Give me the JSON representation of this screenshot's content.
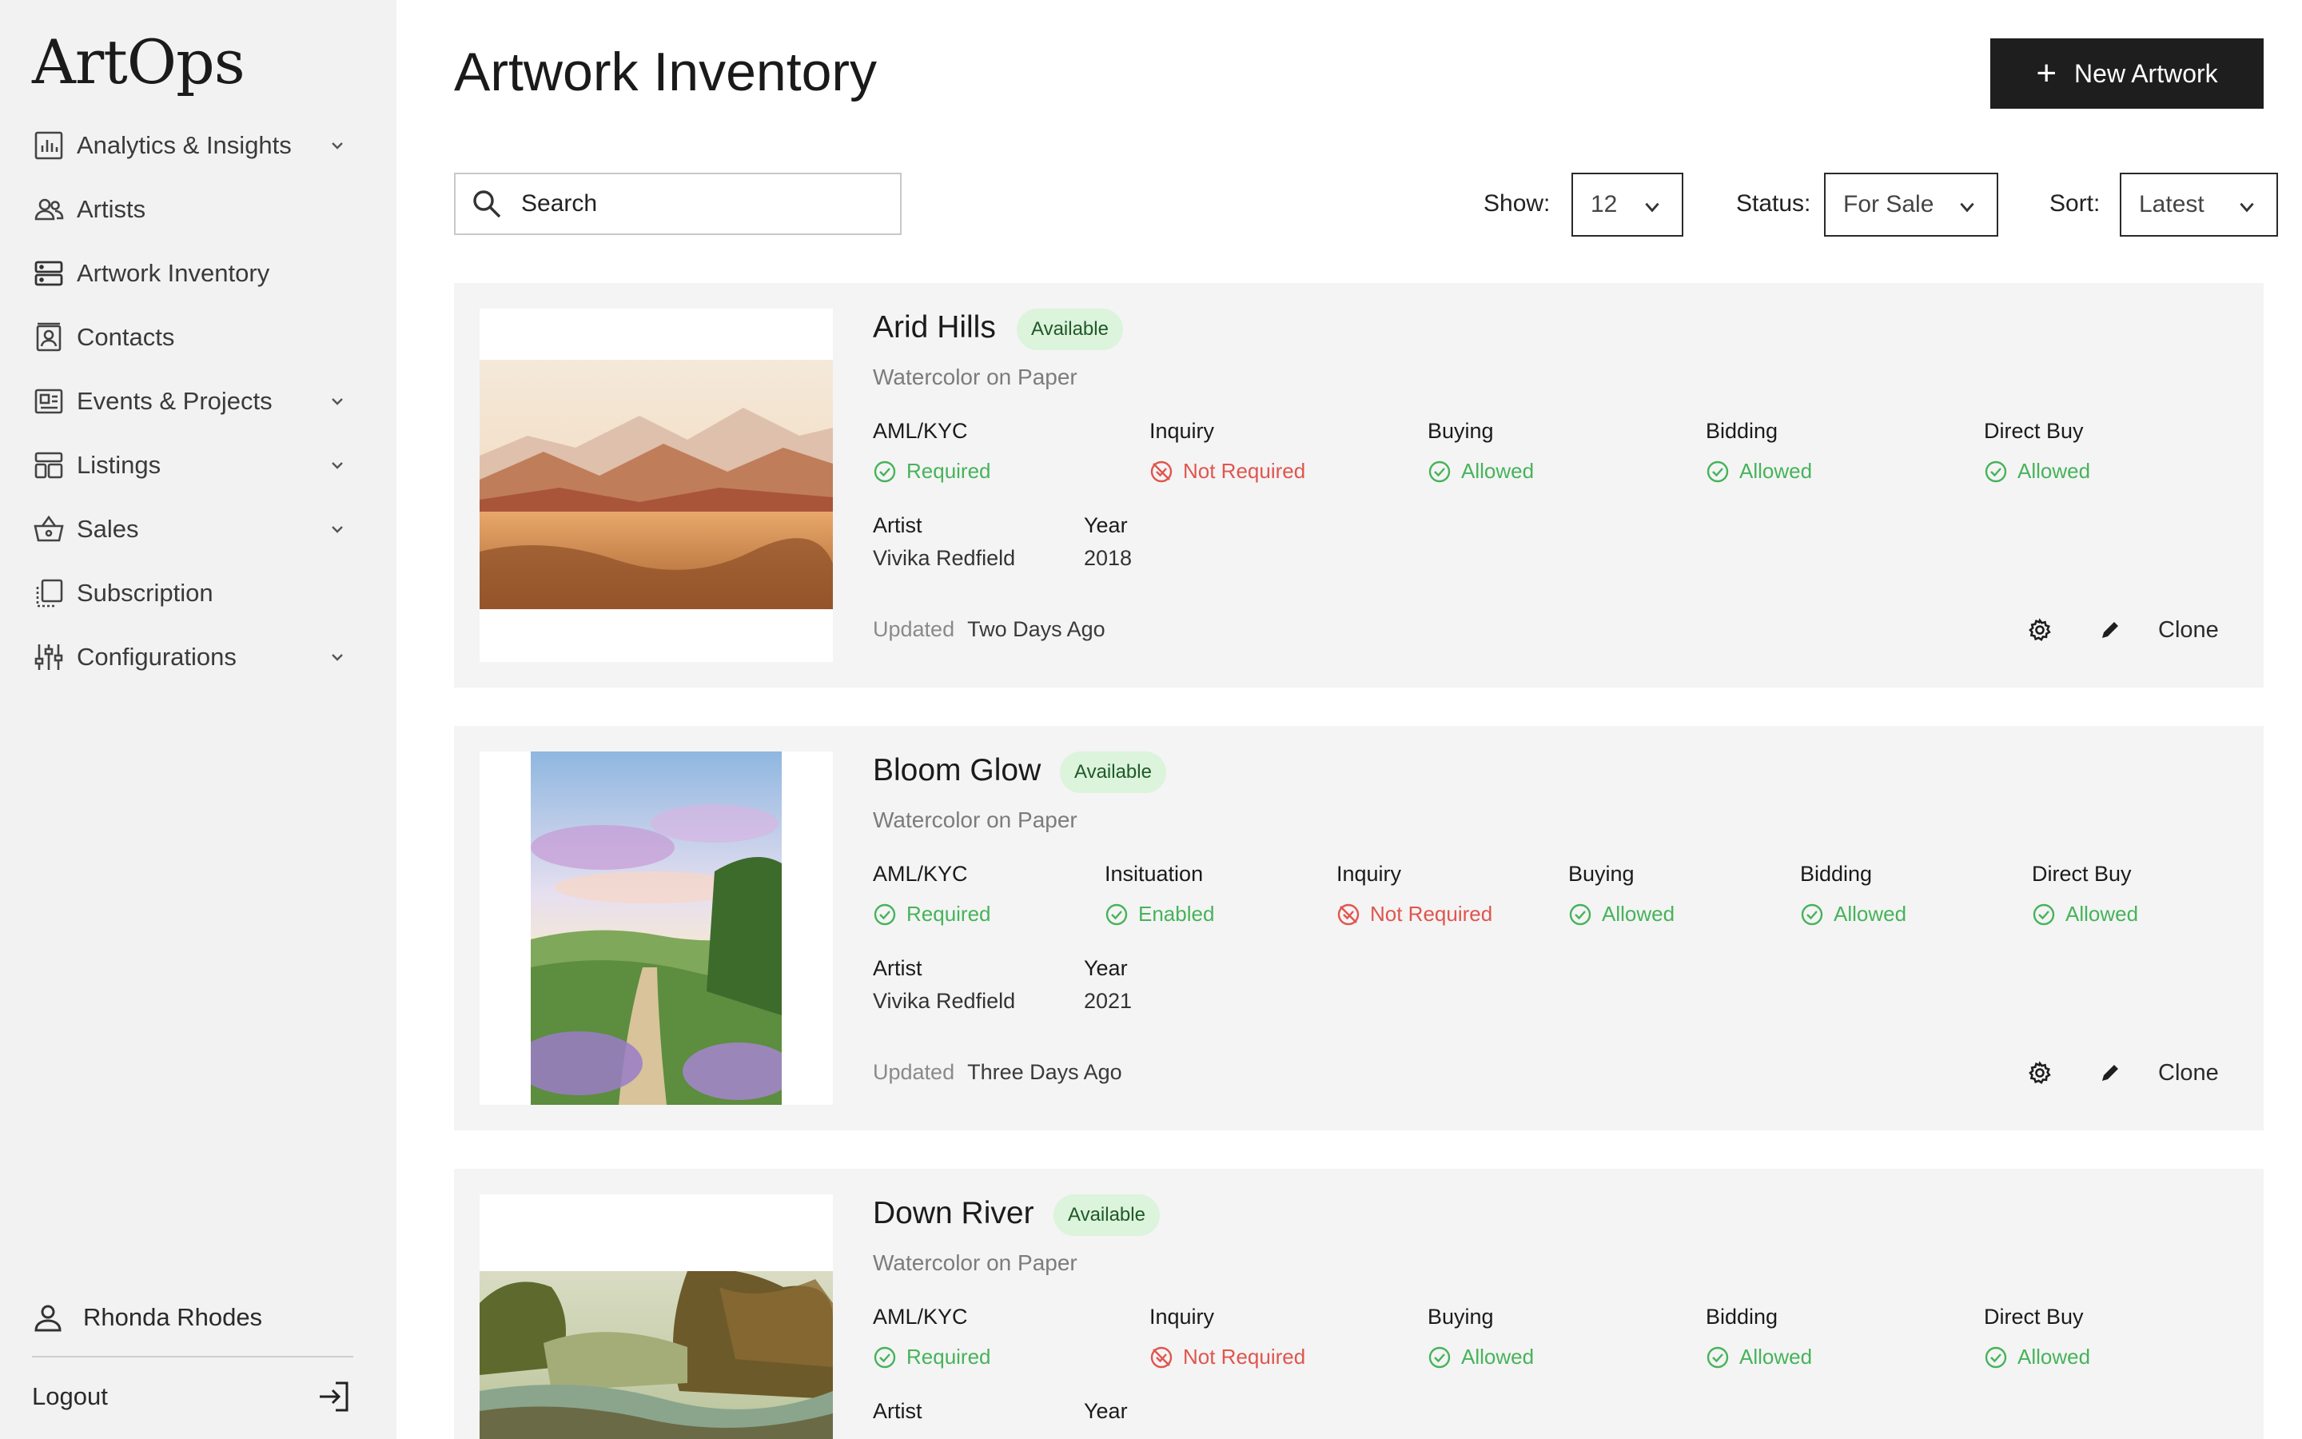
{
  "sidebar": {
    "logo": "ArtOps",
    "items": [
      {
        "label": "Analytics & Insights",
        "icon": "chart-icon",
        "expandable": true
      },
      {
        "label": "Artists",
        "icon": "people-icon",
        "expandable": false
      },
      {
        "label": "Artwork Inventory",
        "icon": "inventory-icon",
        "expandable": false
      },
      {
        "label": "Contacts",
        "icon": "contacts-icon",
        "expandable": false
      },
      {
        "label": "Events & Projects",
        "icon": "events-icon",
        "expandable": true
      },
      {
        "label": "Listings",
        "icon": "listings-icon",
        "expandable": true
      },
      {
        "label": "Sales",
        "icon": "basket-icon",
        "expandable": true
      },
      {
        "label": "Subscription",
        "icon": "subscription-icon",
        "expandable": false
      },
      {
        "label": "Configurations",
        "icon": "sliders-icon",
        "expandable": true
      }
    ],
    "user_name": "Rhonda Rhodes",
    "logout_label": "Logout"
  },
  "header": {
    "title": "Artwork Inventory",
    "new_button": "New Artwork"
  },
  "filters": {
    "search_placeholder": "Search",
    "show_label": "Show:",
    "show_value": "12",
    "status_label": "Status:",
    "status_value": "For Sale",
    "sort_label": "Sort:",
    "sort_value": "Latest"
  },
  "artworks": [
    {
      "title": "Arid Hills",
      "badge": "Available",
      "medium": "Watercolor on Paper",
      "attributes": [
        {
          "label": "AML/KYC",
          "value": "Required",
          "state": "ok"
        },
        {
          "label": "Inquiry",
          "value": "Not Required",
          "state": "bad"
        },
        {
          "label": "Buying",
          "value": "Allowed",
          "state": "ok"
        },
        {
          "label": "Bidding",
          "value": "Allowed",
          "state": "ok"
        },
        {
          "label": "Direct Buy",
          "value": "Allowed",
          "state": "ok"
        }
      ],
      "artist_label": "Artist",
      "artist": "Vivika Redfield",
      "year_label": "Year",
      "year": "2018",
      "updated_label": "Updated",
      "updated": "Two Days Ago",
      "clone_label": "Clone"
    },
    {
      "title": "Bloom Glow",
      "badge": "Available",
      "medium": "Watercolor on Paper",
      "attributes": [
        {
          "label": "AML/KYC",
          "value": "Required",
          "state": "ok"
        },
        {
          "label": "Insituation",
          "value": "Enabled",
          "state": "ok"
        },
        {
          "label": "Inquiry",
          "value": "Not Required",
          "state": "bad"
        },
        {
          "label": "Buying",
          "value": "Allowed",
          "state": "ok"
        },
        {
          "label": "Bidding",
          "value": "Allowed",
          "state": "ok"
        },
        {
          "label": "Direct Buy",
          "value": "Allowed",
          "state": "ok"
        }
      ],
      "artist_label": "Artist",
      "artist": "Vivika Redfield",
      "year_label": "Year",
      "year": "2021",
      "updated_label": "Updated",
      "updated": "Three Days Ago",
      "clone_label": "Clone"
    },
    {
      "title": "Down River",
      "badge": "Available",
      "medium": "Watercolor on Paper",
      "attributes": [
        {
          "label": "AML/KYC",
          "value": "Required",
          "state": "ok"
        },
        {
          "label": "Inquiry",
          "value": "Not Required",
          "state": "bad"
        },
        {
          "label": "Buying",
          "value": "Allowed",
          "state": "ok"
        },
        {
          "label": "Bidding",
          "value": "Allowed",
          "state": "ok"
        },
        {
          "label": "Direct Buy",
          "value": "Allowed",
          "state": "ok"
        }
      ],
      "artist_label": "Artist",
      "artist": "",
      "year_label": "Year",
      "year": "",
      "updated_label": "",
      "updated": "",
      "clone_label": ""
    }
  ],
  "colors": {
    "sidebar_bg": "#f2f2f2",
    "card_bg": "#f4f4f4",
    "primary_button": "#1e1e1e",
    "ok_green": "#46b35a",
    "bad_red": "#e0554e",
    "badge_bg": "#dcf3dc"
  }
}
